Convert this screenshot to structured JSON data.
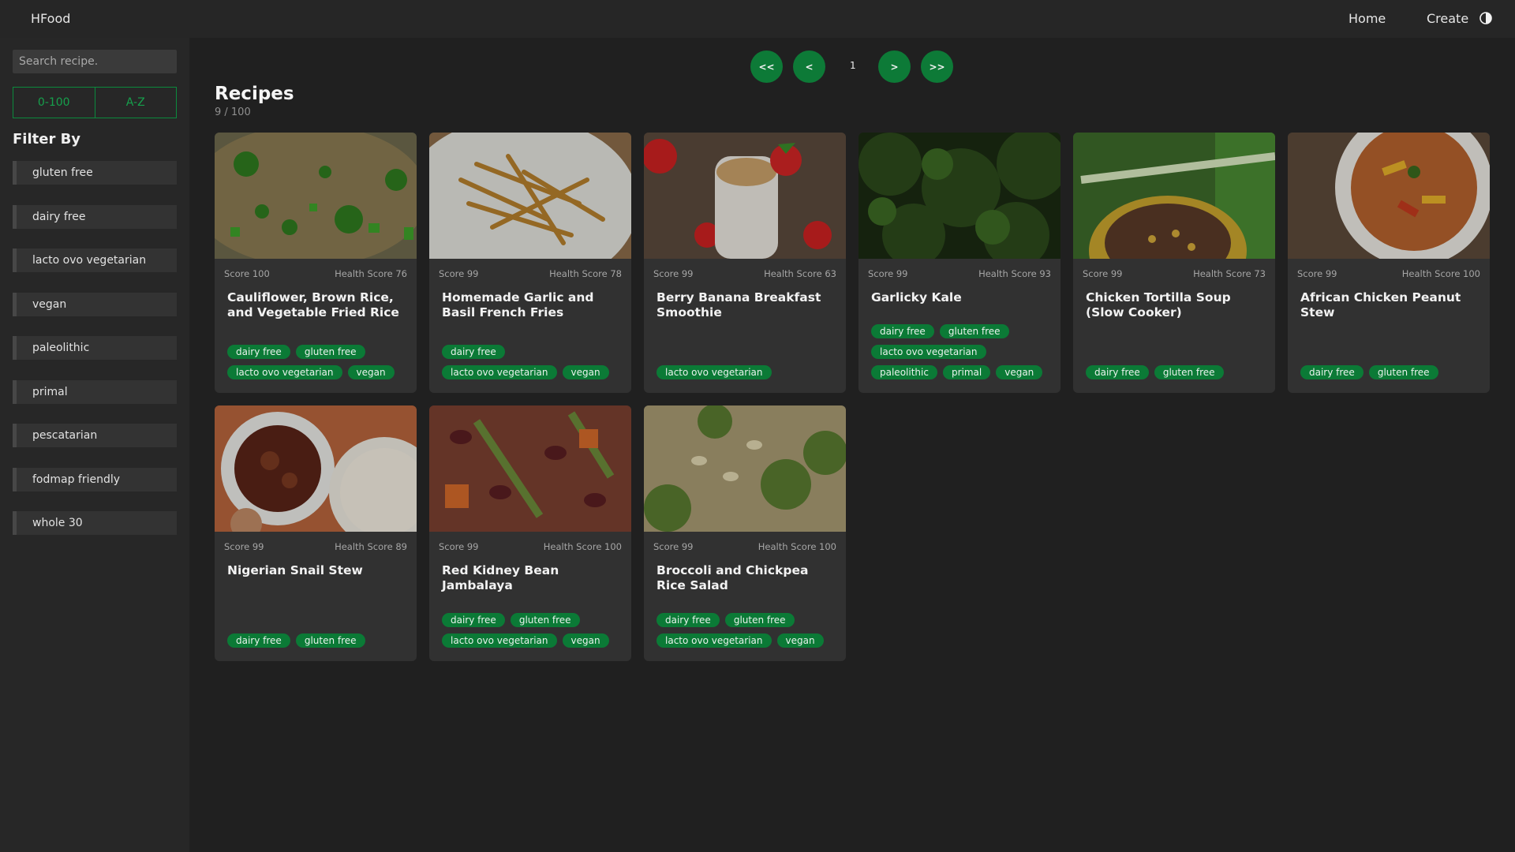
{
  "navbar": {
    "brand": "HFood",
    "home": "Home",
    "create": "Create",
    "theme_icon": "half-moon-icon"
  },
  "sidebar": {
    "search_placeholder": "Search recipe.",
    "sort": [
      "0-100",
      "A-Z"
    ],
    "filter_title": "Filter By",
    "filters": [
      "gluten free",
      "dairy free",
      "lacto ovo vegetarian",
      "vegan",
      "paleolithic",
      "primal",
      "pescatarian",
      "fodmap friendly",
      "whole 30"
    ]
  },
  "pagination": {
    "first": "<<",
    "prev": "<",
    "page": "1",
    "next": ">",
    "last": ">>"
  },
  "main": {
    "title": "Recipes",
    "count": "9 / 100"
  },
  "colors": {
    "accent": "#0b7a36",
    "background": "#202020",
    "card": "#313131"
  },
  "recipes": [
    {
      "score": "Score 100",
      "health": "Health Score 76",
      "title": "Cauliflower, Brown Rice, and Vegetable Fried Rice",
      "tags": [
        "dairy free",
        "gluten free",
        "lacto ovo vegetarian",
        "vegan"
      ],
      "image": "fried rice with green vegetables"
    },
    {
      "score": "Score 99",
      "health": "Health Score 78",
      "title": "Homemade Garlic and Basil French Fries",
      "tags": [
        "dairy free",
        "lacto ovo vegetarian",
        "vegan"
      ],
      "image": "french fries on plate"
    },
    {
      "score": "Score 99",
      "health": "Health Score 63",
      "title": "Berry Banana Breakfast Smoothie",
      "tags": [
        "lacto ovo vegetarian"
      ],
      "image": "smoothie glass with strawberries"
    },
    {
      "score": "Score 99",
      "health": "Health Score 93",
      "title": "Garlicky Kale",
      "tags": [
        "dairy free",
        "gluten free",
        "lacto ovo vegetarian",
        "paleolithic",
        "primal",
        "vegan"
      ],
      "image": "sauteed kale"
    },
    {
      "score": "Score 99",
      "health": "Health Score 73",
      "title": "Chicken Tortilla Soup (Slow Cooker)",
      "tags": [
        "dairy free",
        "gluten free"
      ],
      "image": "soup bowl with green onions"
    },
    {
      "score": "Score 99",
      "health": "Health Score 100",
      "title": "African Chicken Peanut Stew",
      "tags": [
        "dairy free",
        "gluten free"
      ],
      "image": "peanut stew bowl"
    },
    {
      "score": "Score 99",
      "health": "Health Score 89",
      "title": "Nigerian Snail Stew",
      "tags": [
        "dairy free",
        "gluten free"
      ],
      "image": "stew bowl with rice"
    },
    {
      "score": "Score 99",
      "health": "Health Score 100",
      "title": "Red Kidney Bean Jambalaya",
      "tags": [
        "dairy free",
        "gluten free",
        "lacto ovo vegetarian",
        "vegan"
      ],
      "image": "bean jambalaya"
    },
    {
      "score": "Score 99",
      "health": "Health Score 100",
      "title": "Broccoli and Chickpea Rice Salad",
      "tags": [
        "dairy free",
        "gluten free",
        "lacto ovo vegetarian",
        "vegan"
      ],
      "image": "broccoli rice salad"
    }
  ]
}
